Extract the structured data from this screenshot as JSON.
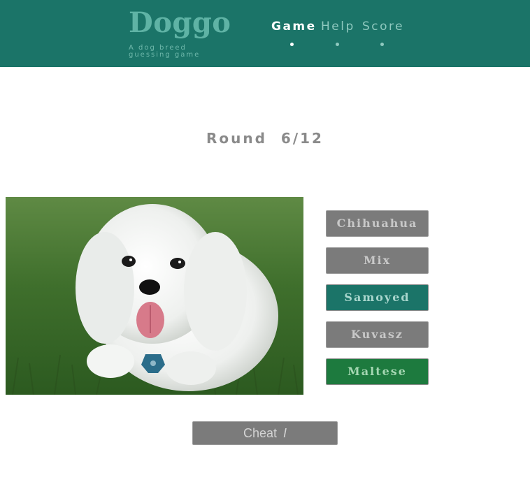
{
  "header": {
    "logo": "Doggo",
    "tagline": "A dog breed guessing game",
    "nav": [
      {
        "label": "Game",
        "active": true
      },
      {
        "label": "Help",
        "active": false
      },
      {
        "label": "Score",
        "active": false
      }
    ]
  },
  "round": {
    "label": "Round",
    "progress": "6/12"
  },
  "photo": {
    "subject": "white-dog-photo"
  },
  "choices": [
    {
      "label": "Chihuahua",
      "state": "default"
    },
    {
      "label": "Mix",
      "state": "default"
    },
    {
      "label": "Samoyed",
      "state": "selected"
    },
    {
      "label": "Kuvasz",
      "state": "default"
    },
    {
      "label": "Maltese",
      "state": "correct"
    }
  ],
  "cheat": {
    "label": "Cheat",
    "icon": "cursor-bar-icon"
  },
  "colors": {
    "header_bg": "#1b7468",
    "button_gray": "#7b7b7b",
    "button_selected": "#1b7468",
    "button_correct": "#1d7a3e"
  }
}
